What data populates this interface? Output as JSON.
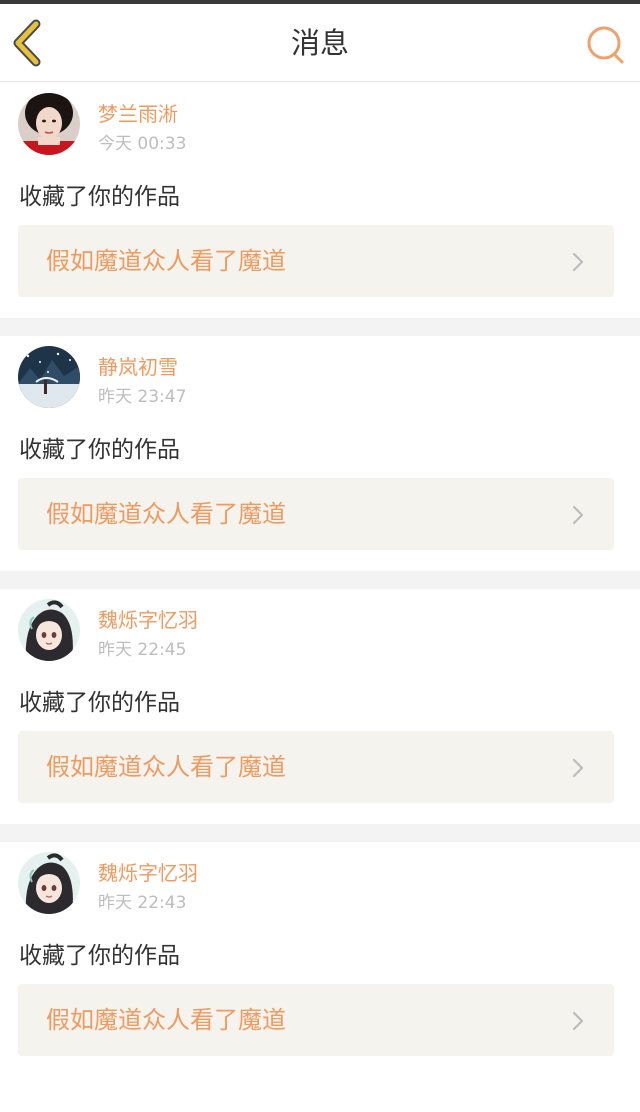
{
  "header": {
    "title": "消息",
    "back_icon": "chevron-left-icon",
    "search_icon": "search-icon",
    "back_color": "#e8c13a",
    "search_color": "#f0a06a"
  },
  "accent_color": "#ef9a5e",
  "messages": [
    {
      "user": "梦兰雨淅",
      "time": "今天 00:33",
      "action": "收藏了你的作品",
      "work": "假如魔道众人看了魔道",
      "avatar": "avatar-woman-portrait"
    },
    {
      "user": "静岚初雪",
      "time": "昨天 23:47",
      "action": "收藏了你的作品",
      "work": "假如魔道众人看了魔道",
      "avatar": "avatar-snow-scene"
    },
    {
      "user": "魏烁字忆羽",
      "time": "昨天 22:45",
      "action": "收藏了你的作品",
      "work": "假如魔道众人看了魔道",
      "avatar": "avatar-anime-character"
    },
    {
      "user": "魏烁字忆羽",
      "time": "昨天 22:43",
      "action": "收藏了你的作品",
      "work": "假如魔道众人看了魔道",
      "avatar": "avatar-anime-character"
    }
  ]
}
